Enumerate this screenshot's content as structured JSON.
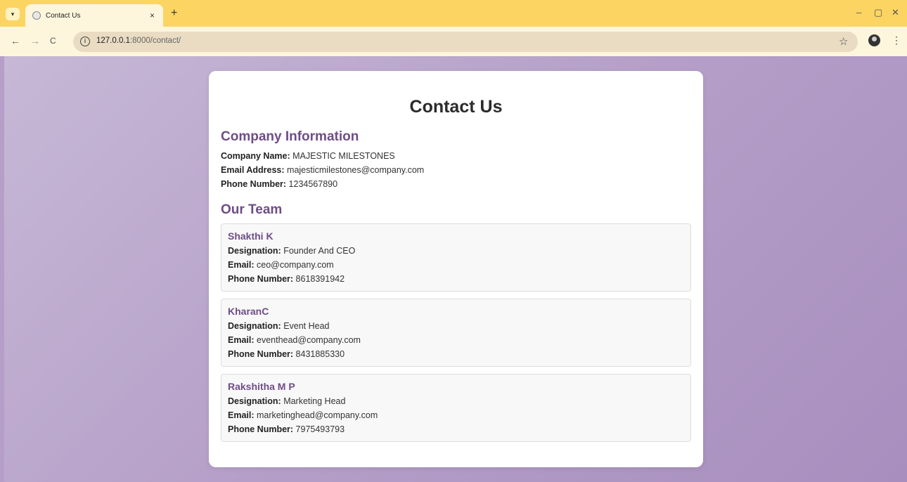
{
  "browser": {
    "tab_title": "Contact Us",
    "tab_close": "×",
    "new_tab": "+",
    "url_host": "127.0.0.1",
    "url_path": ":8000/contact/",
    "minimize": "–",
    "restore": "▢",
    "close": "✕",
    "back": "←",
    "forward": "→",
    "reload": "C",
    "star": "☆",
    "kebab": "⋮",
    "tab_menu": "▾",
    "info": "i"
  },
  "page": {
    "title": "Contact Us",
    "company_heading": "Company Information",
    "company": [
      {
        "label": "Company Name:",
        "value": "MAJESTIC MILESTONES"
      },
      {
        "label": "Email Address:",
        "value": "majesticmilestones@company.com"
      },
      {
        "label": "Phone Number:",
        "value": "1234567890"
      }
    ],
    "team_heading": "Our Team",
    "team": [
      {
        "name": "Shakthi K",
        "designation_label": "Designation:",
        "designation": "Founder And CEO",
        "email_label": "Email:",
        "email": "ceo@company.com",
        "phone_label": "Phone Number:",
        "phone": "8618391942"
      },
      {
        "name": "KharanC",
        "designation_label": "Designation:",
        "designation": "Event Head",
        "email_label": "Email:",
        "email": "eventhead@company.com",
        "phone_label": "Phone Number:",
        "phone": "8431885330"
      },
      {
        "name": "Rakshitha M P",
        "designation_label": "Designation:",
        "designation": "Marketing Head",
        "email_label": "Email:",
        "email": "marketinghead@company.com",
        "phone_label": "Phone Number:",
        "phone": "7975493793"
      }
    ]
  },
  "colors": {
    "tabbar": "#fcd462",
    "heading_purple": "#6f4d87",
    "background": "#b59fc8"
  }
}
